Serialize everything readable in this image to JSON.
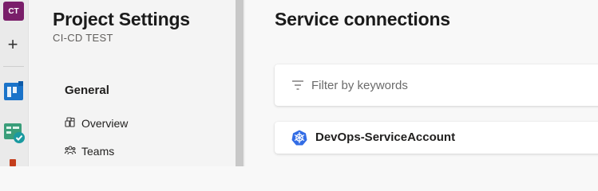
{
  "rail": {
    "avatar_text": "CT",
    "avatar_color": "#7a1f6a",
    "items": [
      "plus-icon",
      "boards-icon",
      "test-plans-icon",
      "artifacts-icon"
    ]
  },
  "sidebar": {
    "title": "Project Settings",
    "subtitle": "CI-CD TEST",
    "section": "General",
    "items": [
      {
        "label": "Overview",
        "icon": "overview-icon"
      },
      {
        "label": "Teams",
        "icon": "teams-icon"
      }
    ]
  },
  "main": {
    "heading": "Service connections",
    "filter": {
      "placeholder": "Filter by keywords",
      "value": ""
    },
    "connections": [
      {
        "name": "DevOps-ServiceAccount",
        "icon": "kubernetes-icon",
        "icon_color": "#326ce5"
      }
    ]
  }
}
